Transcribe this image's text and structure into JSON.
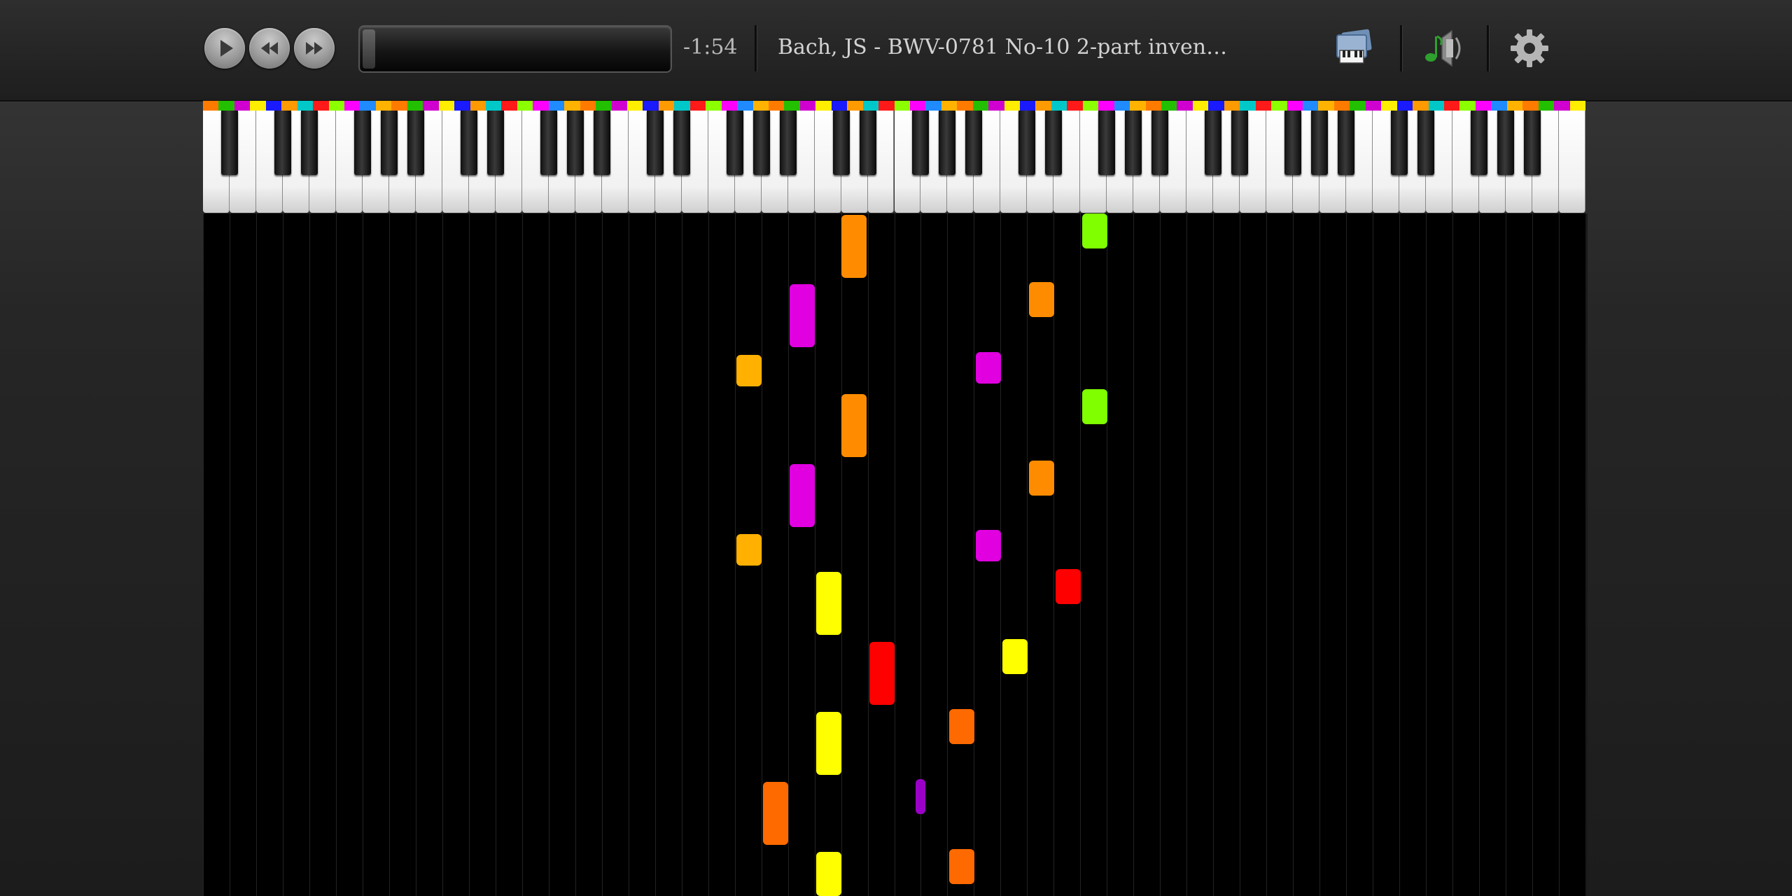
{
  "player": {
    "time_remaining": "-1:54",
    "song_title": "Bach, JS - BWV-0781 No-10 2-part inven…",
    "progress": 0.0
  },
  "icons": {
    "play": "play-icon",
    "rewind": "rewind-icon",
    "fast_forward": "fast-forward-icon",
    "keyboard_picture": "piano-picture-icon",
    "music_volume": "music-speaker-icon",
    "settings": "gear-icon"
  },
  "colors": {
    "orange": "#ff8c00",
    "dark_orange": "#ff6a00",
    "gold": "#ffb000",
    "magenta": "#e000e0",
    "lime": "#7fff00",
    "yellow": "#ffff00",
    "red": "#ff0000",
    "purple": "#9b00c8",
    "key_strip_palette": [
      "#ff7b00",
      "#22c000",
      "#d000d0",
      "#ffee00",
      "#1a1aff",
      "#ff9a00",
      "#00c8c8",
      "#ff1a1a",
      "#8cff00",
      "#ff00ff",
      "#1f8bff",
      "#ffb300"
    ]
  },
  "falling_notes": [
    {
      "col": "magenta",
      "start": 0
    },
    {
      "col": "orange",
      "start": 0
    }
  ]
}
